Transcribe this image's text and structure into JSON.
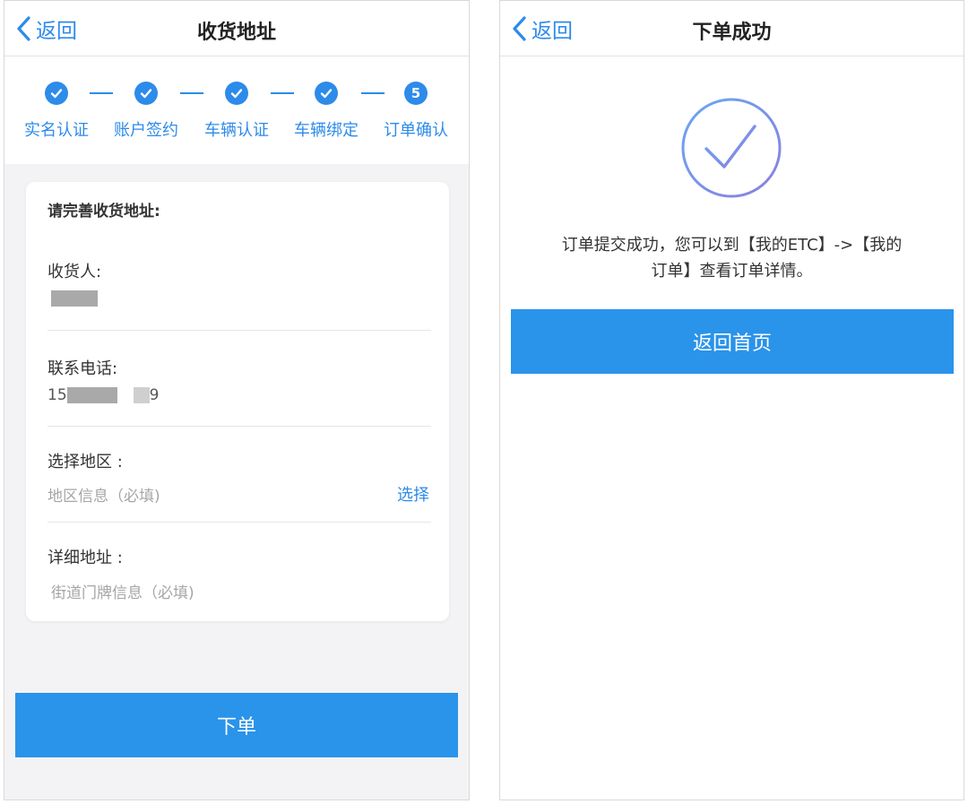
{
  "left": {
    "back_label": "返回",
    "title": "收货地址",
    "steps": [
      "实名认证",
      "账户签约",
      "车辆认证",
      "车辆绑定",
      "订单确认"
    ],
    "current_step_number": "5",
    "form_heading": "请完善收货地址:",
    "recipient_label": "收货人:",
    "phone_label": "联系电话:",
    "phone_prefix": "15",
    "phone_suffix": "9",
    "region_label": "选择地区 :",
    "region_placeholder": "地区信息（必填)",
    "select_label": "选择",
    "detail_label": "详细地址 :",
    "detail_placeholder": "街道门牌信息（必填)",
    "submit_label": "下单"
  },
  "right": {
    "back_label": "返回",
    "title": "下单成功",
    "message_line1": "订单提交成功，您可以到【我的ETC】->【我的",
    "message_line2": "订单】查看订单详情。",
    "home_button_label": "返回首页"
  },
  "colors": {
    "accent": "#2d8bea",
    "button": "#2a93ea",
    "page_bg": "#f3f3f5"
  },
  "icons": {
    "back": "chevron-left-icon",
    "step_done": "check-circle-icon",
    "success": "success-check-circle-icon"
  }
}
